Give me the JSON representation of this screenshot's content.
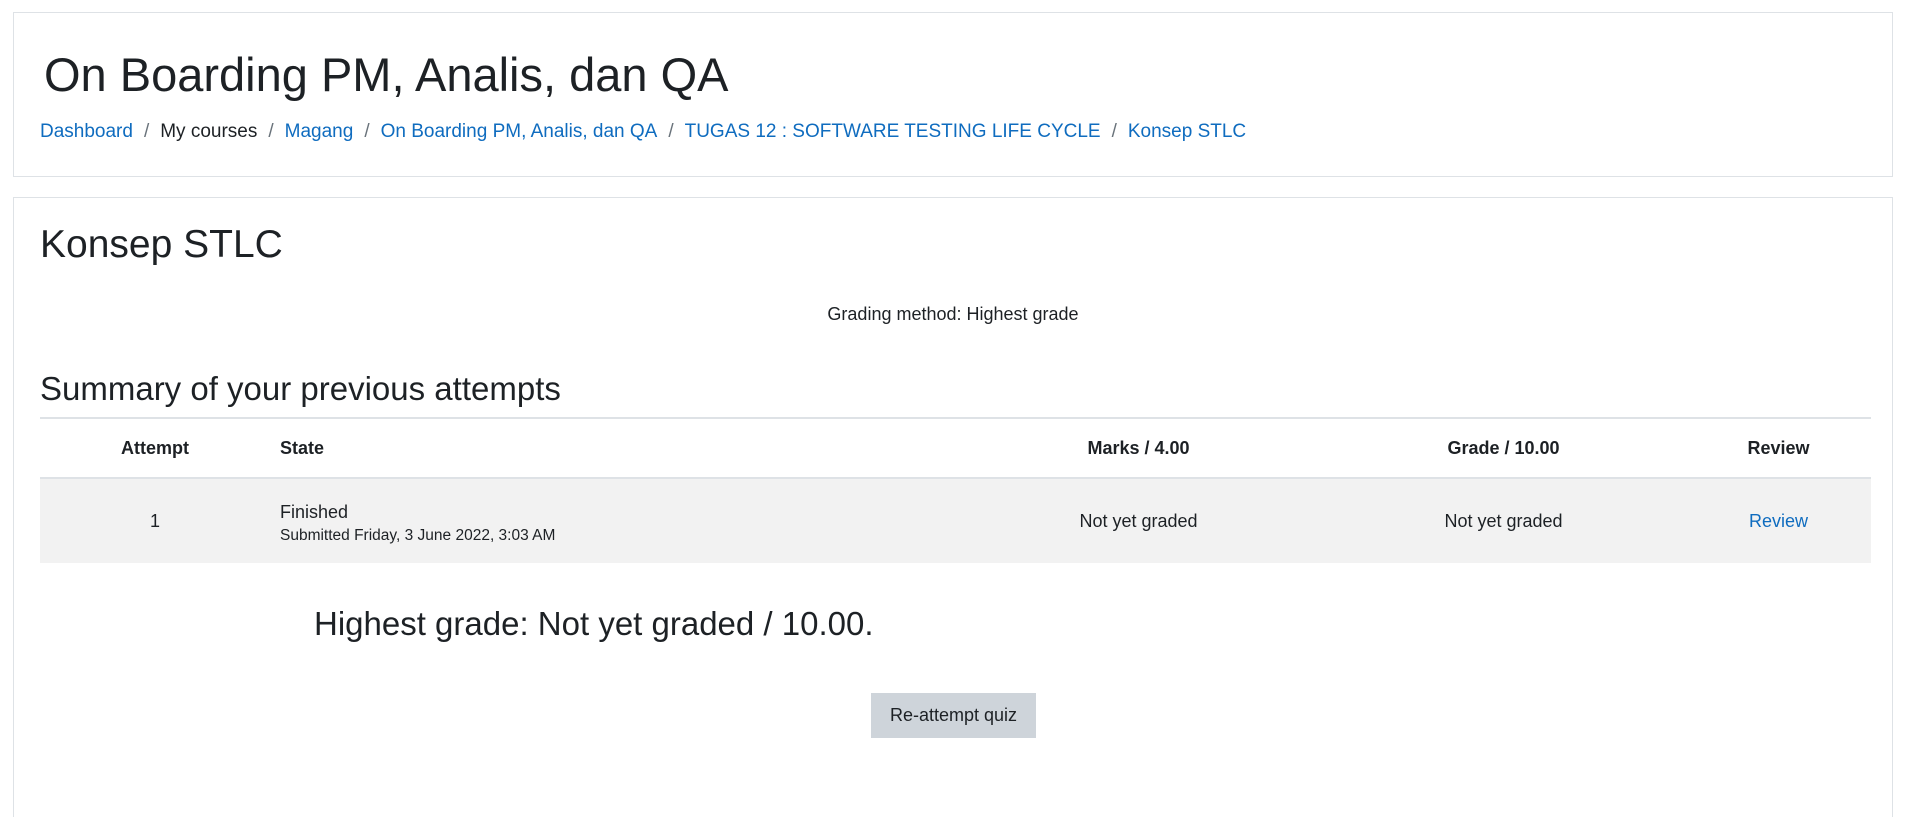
{
  "header": {
    "course_title": "On Boarding PM, Analis, dan QA",
    "breadcrumb": [
      {
        "label": "Dashboard",
        "link": true
      },
      {
        "label": "My courses",
        "link": false
      },
      {
        "label": "Magang",
        "link": true
      },
      {
        "label": "On Boarding PM, Analis, dan QA",
        "link": true
      },
      {
        "label": "TUGAS 12 : SOFTWARE TESTING LIFE CYCLE",
        "link": true
      },
      {
        "label": "Konsep STLC",
        "link": true
      }
    ],
    "separator": "/"
  },
  "quiz": {
    "title": "Konsep STLC",
    "grading_method": "Grading method: Highest grade",
    "summary_heading": "Summary of your previous attempts",
    "table": {
      "headers": {
        "attempt": "Attempt",
        "state": "State",
        "marks": "Marks / 4.00",
        "grade": "Grade / 10.00",
        "review": "Review"
      },
      "rows": [
        {
          "attempt": "1",
          "state": "Finished",
          "submitted": "Submitted Friday, 3 June 2022, 3:03 AM",
          "marks": "Not yet graded",
          "grade": "Not yet graded",
          "review": "Review"
        }
      ]
    },
    "highest_grade": "Highest grade: Not yet graded / 10.00.",
    "reattempt_button": "Re-attempt quiz"
  },
  "colors": {
    "link": "#0f6cbf",
    "row_background": "#f2f2f2",
    "button_background": "#ced4da",
    "border": "#dee2e6"
  }
}
